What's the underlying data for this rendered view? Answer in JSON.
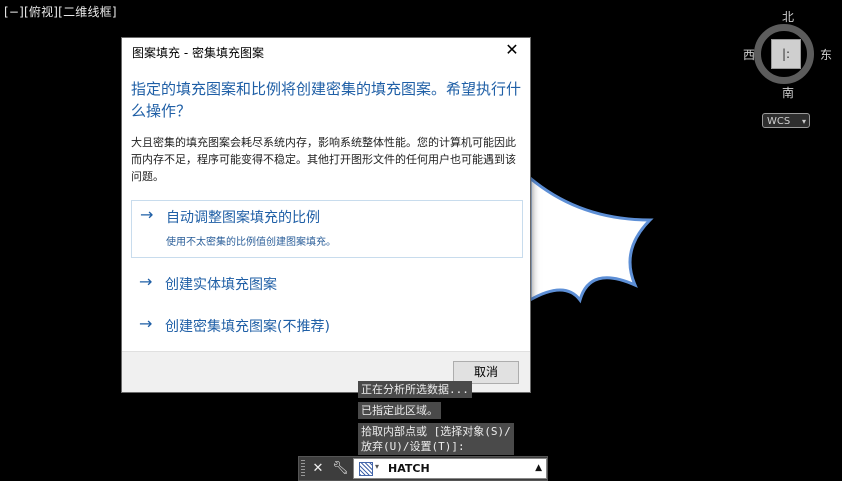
{
  "viewport": {
    "label": "[−][俯视][二维线框]"
  },
  "viewcube": {
    "north": "北",
    "south": "南",
    "west": "西",
    "east": "东",
    "face": "|:",
    "wcs_label": "WCS"
  },
  "dialog": {
    "title": "图案填充 - 密集填充图案",
    "heading": "指定的填充图案和比例将创建密集的填充图案。希望执行什么操作？",
    "description": "大且密集的填充图案会耗尽系统内存，影响系统整体性能。您的计算机可能因此而内存不足，程序可能变得不稳定。其他打开图形文件的任何用户也可能遇到该问题。",
    "options": [
      {
        "label": "自动调整图案填充的比例",
        "sublabel": "使用不太密集的比例值创建图案填充。"
      },
      {
        "label": "创建实体填充图案"
      },
      {
        "label": "创建密集填充图案(不推荐)"
      }
    ],
    "cancel_label": "取消"
  },
  "command_history": [
    "正在分析所选数据...",
    "已指定此区域。",
    "拾取内部点或 [选择对象(S)/",
    "放弃(U)/设置(T)]:"
  ],
  "command_line": {
    "value": "HATCH"
  },
  "colors": {
    "accent": "#1f5fa6",
    "canvas": "#000000"
  }
}
